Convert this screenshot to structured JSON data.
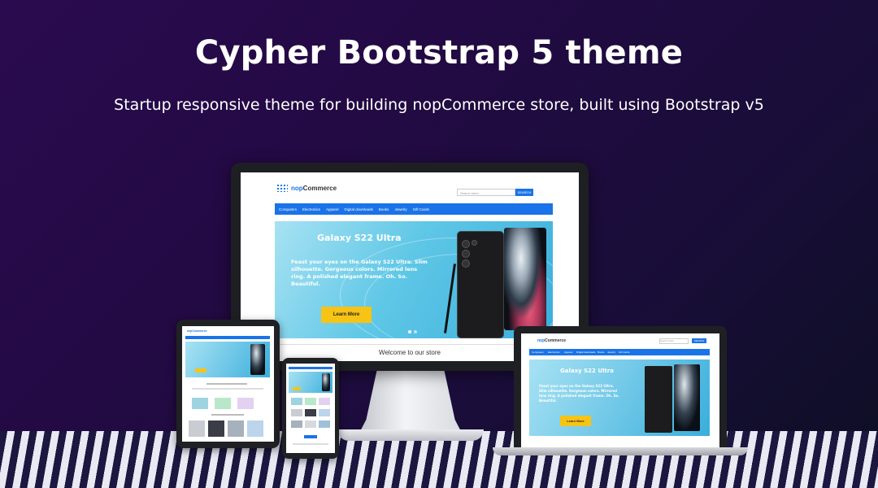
{
  "banner": {
    "title": "Cypher Bootstrap 5 theme",
    "subtitle": "Startup responsive theme for building nopCommerce store, built using Bootstrap v5"
  },
  "store": {
    "logo_prefix": "nop",
    "logo_suffix": "Commerce",
    "search_placeholder": "Search store",
    "search_button": "SEARCH",
    "nav": [
      "Computers",
      "Electronics",
      "Apparel",
      "Digital downloads",
      "Books",
      "Jewelry",
      "Gift Cards"
    ],
    "hero": {
      "title": "Galaxy S22 Ultra",
      "text": "Feast your eyes on the Galaxy S22 Ultra. Slim silhouette. Gorgeous colors. Mirrored lens ring. A polished elegant frame. Oh. So. Beautiful.",
      "button": "Learn More"
    },
    "welcome": "Welcome to our store"
  },
  "colors": {
    "brand_blue": "#1a73e8",
    "button_yellow": "#f7c315",
    "background_purple": "#2a0b4f"
  }
}
